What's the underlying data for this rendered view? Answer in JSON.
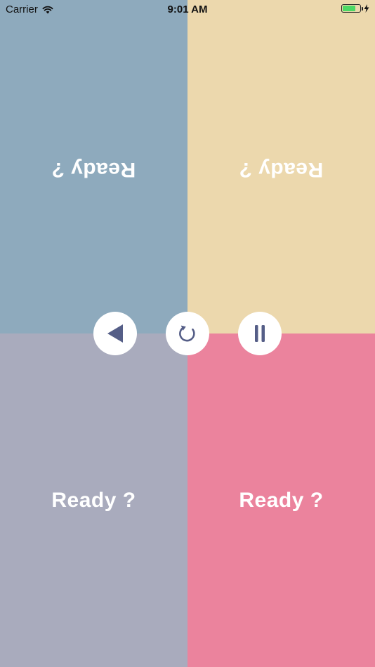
{
  "status_bar": {
    "carrier": "Carrier",
    "time": "9:01 AM",
    "battery_level": 0.75
  },
  "quadrants": [
    {
      "position": "top-left",
      "label": "Ready ?",
      "color": "#8eaabd",
      "rotated": true
    },
    {
      "position": "top-right",
      "label": "Ready ?",
      "color": "#ecd8ad",
      "rotated": true
    },
    {
      "position": "bottom-left",
      "label": "Ready ?",
      "color": "#a9abbd",
      "rotated": false
    },
    {
      "position": "bottom-right",
      "label": "Ready ?",
      "color": "#eb839d",
      "rotated": false
    }
  ],
  "controls": {
    "back": {
      "icon": "back-triangle-icon"
    },
    "restart": {
      "icon": "restart-icon"
    },
    "pause": {
      "icon": "pause-icon"
    },
    "icon_color": "#555e87",
    "button_color": "#ffffff"
  }
}
